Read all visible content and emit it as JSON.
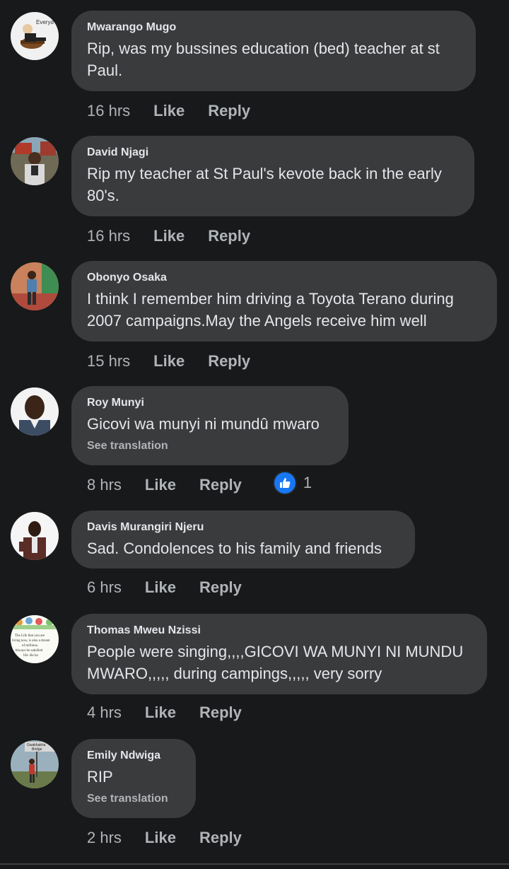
{
  "comments": [
    {
      "author": "Mwarango Mugo",
      "text": "Rip, was my bussines education (bed) teacher at st Paul.",
      "time": "16 hrs",
      "like": "Like",
      "reply": "Reply"
    },
    {
      "author": "David Njagi",
      "text": "Rip my teacher at St Paul's kevote back in the early 80's.",
      "time": "16 hrs",
      "like": "Like",
      "reply": "Reply"
    },
    {
      "author": "Obonyo Osaka",
      "text": "I think I remember him driving a Toyota Terano during 2007 campaigns.May the Angels receive him well",
      "time": "15 hrs",
      "like": "Like",
      "reply": "Reply"
    },
    {
      "author": "Roy Munyi",
      "text": "Gicovi wa munyi ni mundû mwaro",
      "see_translation": "See translation",
      "time": "8 hrs",
      "like": "Like",
      "reply": "Reply",
      "reaction_count": "1"
    },
    {
      "author": "Davis Murangiri Njeru",
      "text": "Sad. Condolences to his family and friends",
      "time": "6 hrs",
      "like": "Like",
      "reply": "Reply"
    },
    {
      "author": "Thomas Mweu Nzissi",
      "text": "People were singing,,,,GICOVI WA MUNYI NI MUNDU MWARO,,,,, during campings,,,,, very sorry",
      "time": "4 hrs",
      "like": "Like",
      "reply": "Reply"
    },
    {
      "author": "Emily Ndwiga",
      "text": "RIP",
      "see_translation": "See translation",
      "time": "2 hrs",
      "like": "Like",
      "reply": "Reply"
    }
  ],
  "avatar_images": {
    "c0": {
      "caption": "Everyd"
    },
    "c5": {
      "caption_lines": [
        "The Life that you are",
        "living now, is also a dream",
        "of millions.",
        "Always be satisfied",
        "life. Be ha"
      ]
    },
    "c6": {
      "caption_lines": [
        "Gwakhakha",
        "Bridge"
      ]
    }
  },
  "colors": {
    "background": "#18191a",
    "bubble": "#3a3b3c",
    "primary_text": "#e4e6eb",
    "secondary_text": "#b0b3b8",
    "like_reaction": "#1877f2"
  },
  "icons": {
    "like_reaction": "thumbs-up-icon"
  }
}
